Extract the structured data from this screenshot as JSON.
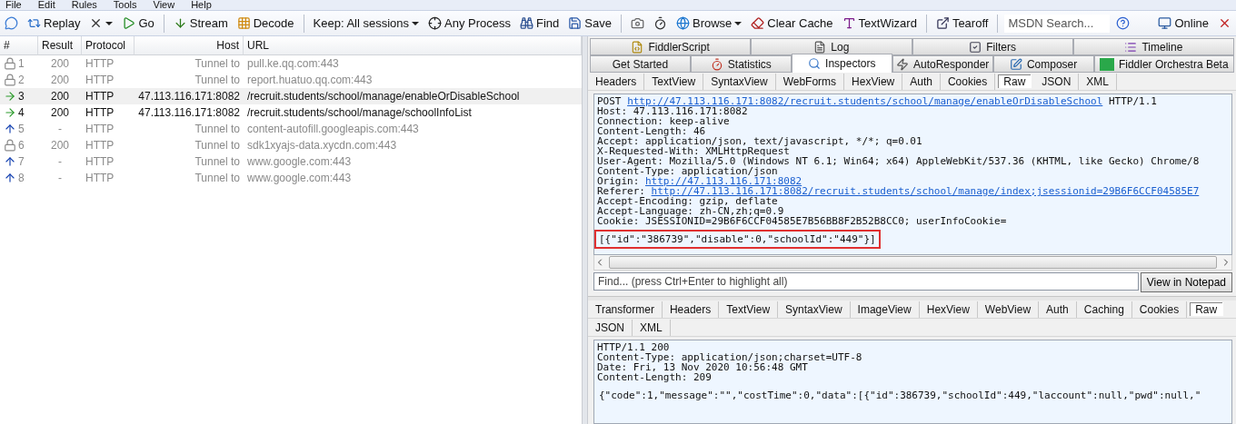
{
  "menu": [
    "File",
    "Edit",
    "Rules",
    "Tools",
    "View",
    "Help"
  ],
  "toolbar": [
    {
      "kind": "button"
    },
    {
      "kind": "button",
      "label": "Replay"
    },
    {
      "kind": "button",
      "dropdown": true
    },
    {
      "kind": "button",
      "label": "Go"
    },
    {
      "kind": "separator"
    },
    {
      "kind": "button",
      "label": "Stream"
    },
    {
      "kind": "button",
      "label": "Decode"
    },
    {
      "kind": "separator"
    },
    {
      "kind": "button",
      "label": "Keep: All sessions",
      "dropdown": true
    },
    {
      "kind": "button",
      "label": "Any Process"
    },
    {
      "kind": "button",
      "label": "Find"
    },
    {
      "kind": "button",
      "label": "Save"
    },
    {
      "kind": "separator"
    },
    {
      "kind": "button"
    },
    {
      "kind": "button"
    },
    {
      "kind": "button",
      "label": "Browse",
      "dropdown": true
    },
    {
      "kind": "button",
      "label": "Clear Cache"
    },
    {
      "kind": "button",
      "label": "TextWizard"
    },
    {
      "kind": "separator"
    },
    {
      "kind": "button",
      "label": "Tearoff"
    },
    {
      "kind": "separator"
    },
    {
      "kind": "search",
      "placeholder": "MSDN Search..."
    },
    {
      "kind": "button"
    },
    {
      "kind": "spacer"
    },
    {
      "kind": "button",
      "label": "Online"
    },
    {
      "kind": "button"
    }
  ],
  "sessions": {
    "columns": [
      "#",
      "Result",
      "Protocol",
      "Host",
      "URL"
    ],
    "rows": [
      {
        "number": "1",
        "result": "200",
        "protocol": "HTTP",
        "host": "Tunnel to",
        "url": "pull.ke.qq.com:443",
        "kind": "lock",
        "dimmed": true,
        "selected": false
      },
      {
        "number": "2",
        "result": "200",
        "protocol": "HTTP",
        "host": "Tunnel to",
        "url": "report.huatuo.qq.com:443",
        "kind": "lock",
        "dimmed": true,
        "selected": false
      },
      {
        "number": "3",
        "result": "200",
        "protocol": "HTTP",
        "host": "47.113.116.171:8082",
        "url": "/recruit.students/school/manage/enableOrDisableSchool",
        "kind": "request",
        "dimmed": false,
        "selected": true
      },
      {
        "number": "4",
        "result": "200",
        "protocol": "HTTP",
        "host": "47.113.116.171:8082",
        "url": "/recruit.students/school/manage/schoolInfoList",
        "kind": "request",
        "dimmed": false,
        "selected": false
      },
      {
        "number": "5",
        "result": "-",
        "protocol": "HTTP",
        "host": "Tunnel to",
        "url": "content-autofill.googleapis.com:443",
        "kind": "upload",
        "dimmed": true,
        "selected": false
      },
      {
        "number": "6",
        "result": "200",
        "protocol": "HTTP",
        "host": "Tunnel to",
        "url": "sdk1xyajs-data.xycdn.com:443",
        "kind": "lock",
        "dimmed": true,
        "selected": false
      },
      {
        "number": "7",
        "result": "-",
        "protocol": "HTTP",
        "host": "Tunnel to",
        "url": "www.google.com:443",
        "kind": "upload",
        "dimmed": true,
        "selected": false
      },
      {
        "number": "8",
        "result": "-",
        "protocol": "HTTP",
        "host": "Tunnel to",
        "url": "www.google.com:443",
        "kind": "upload",
        "dimmed": true,
        "selected": false
      }
    ]
  },
  "main_tabs": [
    [
      {
        "label": "FiddlerScript",
        "selected": false
      },
      {
        "label": "Log",
        "selected": false
      },
      {
        "label": "Filters",
        "selected": false
      },
      {
        "label": "Timeline",
        "selected": false
      }
    ],
    [
      {
        "label": "Get Started",
        "selected": false
      },
      {
        "label": "Statistics",
        "selected": false
      },
      {
        "label": "Inspectors",
        "selected": true
      },
      {
        "label": "AutoResponder",
        "selected": false
      },
      {
        "label": "Composer",
        "selected": false
      },
      {
        "label": "Fiddler Orchestra Beta",
        "selected": false
      }
    ]
  ],
  "request": {
    "tab_rows": [
      [
        {
          "label": "Headers",
          "selected": false
        },
        {
          "label": "TextView",
          "selected": false
        },
        {
          "label": "SyntaxView",
          "selected": false
        },
        {
          "label": "WebForms",
          "selected": false
        },
        {
          "label": "HexView",
          "selected": false
        },
        {
          "label": "Auth",
          "selected": false
        },
        {
          "label": "Cookies",
          "selected": false
        },
        {
          "label": "Raw",
          "selected": true
        },
        {
          "label": "JSON",
          "selected": false
        },
        {
          "label": "XML",
          "selected": false
        }
      ]
    ],
    "lines": [
      {
        "text": "POST ",
        "link": "http://47.113.116.171:8082/recruit.students/school/manage/enableOrDisableSchool",
        "after": " HTTP/1.1"
      },
      {
        "text": "Host: 47.113.116.171:8082"
      },
      {
        "text": "Connection: keep-alive"
      },
      {
        "text": "Content-Length: 46"
      },
      {
        "text": "Accept: application/json, text/javascript, */*; q=0.01"
      },
      {
        "text": "X-Requested-With: XMLHttpRequest"
      },
      {
        "text": "User-Agent: Mozilla/5.0 (Windows NT 6.1; Win64; x64) AppleWebKit/537.36 (KHTML, like Gecko) Chrome/8"
      },
      {
        "text": "Content-Type: application/json"
      },
      {
        "text": "Origin: ",
        "link": "http://47.113.116.171:8082"
      },
      {
        "text": "Referer: ",
        "link": "http://47.113.116.171:8082/recruit.students/school/manage/index;jsessionid=29B6F6CCF04585E7"
      },
      {
        "text": "Accept-Encoding: gzip, deflate"
      },
      {
        "text": "Accept-Language: zh-CN,zh;q=0.9"
      },
      {
        "text": "Cookie: JSESSIONID=29B6F6CCF04585E7B56BB8F2B52B8CC0; userInfoCookie="
      }
    ],
    "body": {
      "text": "[{\"id\":\"386739\",\"disable\":0,\"schoolId\":\"449\"}]",
      "highlighted": true
    },
    "find": {
      "placeholder": "Find... (press Ctrl+Enter to highlight all)"
    },
    "notepad_button": "View in Notepad"
  },
  "response": {
    "tab_rows": [
      [
        {
          "label": "Transformer",
          "selected": false
        },
        {
          "label": "Headers",
          "selected": false
        },
        {
          "label": "TextView",
          "selected": false
        },
        {
          "label": "SyntaxView",
          "selected": false
        },
        {
          "label": "ImageView",
          "selected": false
        },
        {
          "label": "HexView",
          "selected": false
        },
        {
          "label": "WebView",
          "selected": false
        },
        {
          "label": "Auth",
          "selected": false
        },
        {
          "label": "Caching",
          "selected": false
        },
        {
          "label": "Cookies",
          "selected": false
        },
        {
          "label": "Raw",
          "selected": true
        }
      ],
      [
        {
          "label": "JSON",
          "selected": false
        },
        {
          "label": "XML",
          "selected": false
        }
      ]
    ],
    "lines": [
      {
        "text": "HTTP/1.1 200"
      },
      {
        "text": "Content-Type: application/json;charset=UTF-8"
      },
      {
        "text": "Date: Fri, 13 Nov 2020 10:56:48 GMT"
      },
      {
        "text": "Content-Length: 209"
      }
    ],
    "body": {
      "text": "{\"code\":1,\"message\":\"\",\"costTime\":0,\"data\":[{\"id\":386739,\"schoolId\":449,\"laccount\":null,\"pwd\":null,\"",
      "highlighted": false
    }
  }
}
